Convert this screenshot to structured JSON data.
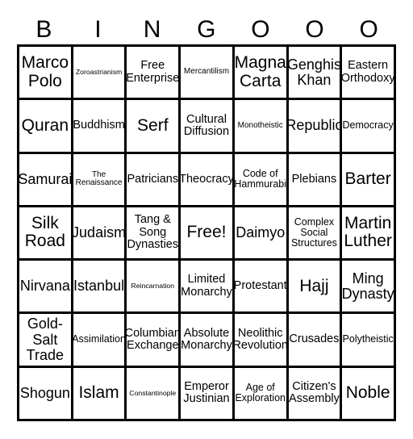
{
  "card": {
    "header_letters": [
      "B",
      "I",
      "N",
      "G",
      "O",
      "O",
      "O"
    ],
    "columns": 7,
    "rows": 7,
    "border_color": "#000000",
    "background_color": "#ffffff",
    "text_color": "#000000",
    "free_space_label": "Free!",
    "free_space_position": {
      "row": 4,
      "col": 4
    },
    "cells": [
      [
        {
          "text": "Marco Polo",
          "size": "xl"
        },
        {
          "text": "Zoroastrianism",
          "size": "xxs"
        },
        {
          "text": "Free Enterprise",
          "size": "md"
        },
        {
          "text": "Mercantilism",
          "size": "xs"
        },
        {
          "text": "Magna Carta",
          "size": "xl"
        },
        {
          "text": "Genghis Khan",
          "size": "lg"
        },
        {
          "text": "Eastern Orthodoxy",
          "size": "md"
        }
      ],
      [
        {
          "text": "Quran",
          "size": "xl"
        },
        {
          "text": "Buddhism",
          "size": "md"
        },
        {
          "text": "Serf",
          "size": "xl"
        },
        {
          "text": "Cultural Diffusion",
          "size": "md"
        },
        {
          "text": "Monotheistic",
          "size": "xs"
        },
        {
          "text": "Republic",
          "size": "lg"
        },
        {
          "text": "Democracy",
          "size": "sm"
        }
      ],
      [
        {
          "text": "Samurai",
          "size": "lg"
        },
        {
          "text": "The Renaissance",
          "size": "xs"
        },
        {
          "text": "Patricians",
          "size": "md"
        },
        {
          "text": "Theocracy",
          "size": "md"
        },
        {
          "text": "Code of Hammurabi",
          "size": "sm"
        },
        {
          "text": "Plebians",
          "size": "md"
        },
        {
          "text": "Barter",
          "size": "xl"
        }
      ],
      [
        {
          "text": "Silk Road",
          "size": "xl"
        },
        {
          "text": "Judaism",
          "size": "lg"
        },
        {
          "text": "Tang & Song Dynasties",
          "size": "md"
        },
        {
          "text": "Free!",
          "size": "xl"
        },
        {
          "text": "Daimyo",
          "size": "lg"
        },
        {
          "text": "Complex Social Structures",
          "size": "sm"
        },
        {
          "text": "Martin Luther",
          "size": "xl"
        }
      ],
      [
        {
          "text": "Nirvana",
          "size": "lg"
        },
        {
          "text": "Istanbul",
          "size": "lg"
        },
        {
          "text": "Reincarnation",
          "size": "xxs"
        },
        {
          "text": "Limited Monarchy",
          "size": "md"
        },
        {
          "text": "Protestant",
          "size": "md"
        },
        {
          "text": "Hajj",
          "size": "xl"
        },
        {
          "text": "Ming Dynasty",
          "size": "lg"
        }
      ],
      [
        {
          "text": "Gold-Salt Trade",
          "size": "lg"
        },
        {
          "text": "Assimilation",
          "size": "sm"
        },
        {
          "text": "Columbian Exchange",
          "size": "md"
        },
        {
          "text": "Absolute Monarchy",
          "size": "md"
        },
        {
          "text": "Neolithic Revolution",
          "size": "md"
        },
        {
          "text": "Crusades",
          "size": "md"
        },
        {
          "text": "Polytheistic",
          "size": "sm"
        }
      ],
      [
        {
          "text": "Shogun",
          "size": "lg"
        },
        {
          "text": "Islam",
          "size": "xl"
        },
        {
          "text": "Constantinople",
          "size": "xxs"
        },
        {
          "text": "Emperor Justinian",
          "size": "md"
        },
        {
          "text": "Age of Exploration",
          "size": "sm"
        },
        {
          "text": "Citizen's Assembly",
          "size": "md"
        },
        {
          "text": "Noble",
          "size": "xl"
        }
      ]
    ]
  }
}
